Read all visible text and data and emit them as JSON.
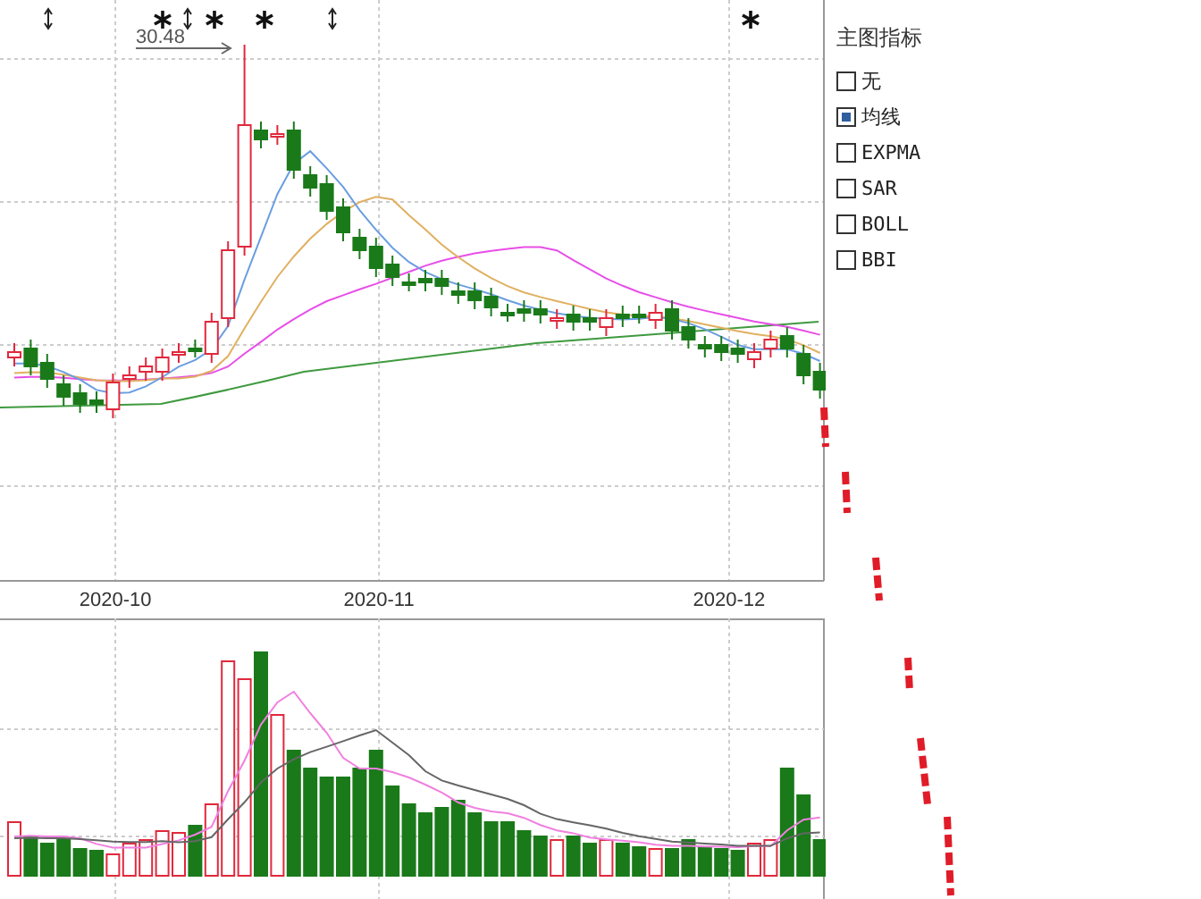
{
  "chart": {
    "price_label": "30.48",
    "x_labels": [
      "2020-10",
      "2020-11",
      "2020-12"
    ]
  },
  "indicator_panel": {
    "title": "主图指标",
    "options": [
      {
        "label": "无",
        "selected": false
      },
      {
        "label": "均线",
        "selected": true
      },
      {
        "label": "EXPMA",
        "selected": false
      },
      {
        "label": "SAR",
        "selected": false
      },
      {
        "label": "BOLL",
        "selected": false
      },
      {
        "label": "BBI",
        "selected": false
      }
    ]
  }
}
